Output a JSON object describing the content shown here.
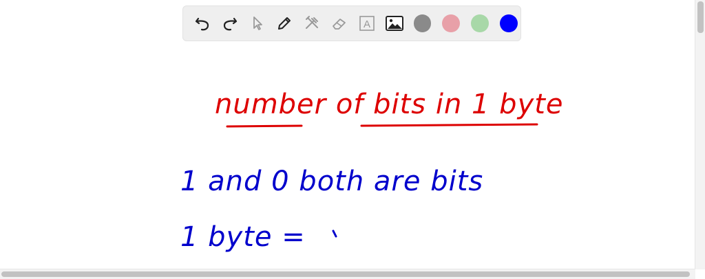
{
  "toolbar": {
    "tools": [
      {
        "name": "undo-icon"
      },
      {
        "name": "redo-icon"
      },
      {
        "name": "pointer-icon"
      },
      {
        "name": "pen-icon"
      },
      {
        "name": "tools-icon"
      },
      {
        "name": "eraser-icon"
      },
      {
        "name": "text-icon",
        "glyph": "A"
      },
      {
        "name": "image-icon"
      }
    ],
    "colors": [
      "#8a8a8a",
      "#e8a0a8",
      "#a8d8a8",
      "#0000ff"
    ]
  },
  "whiteboard": {
    "title": "number of bits in 1 byte",
    "line1": "1 and 0 both are bits",
    "line2": "1 byte = ",
    "title_color": "#dd0000",
    "ink_color": "#0000cc"
  }
}
